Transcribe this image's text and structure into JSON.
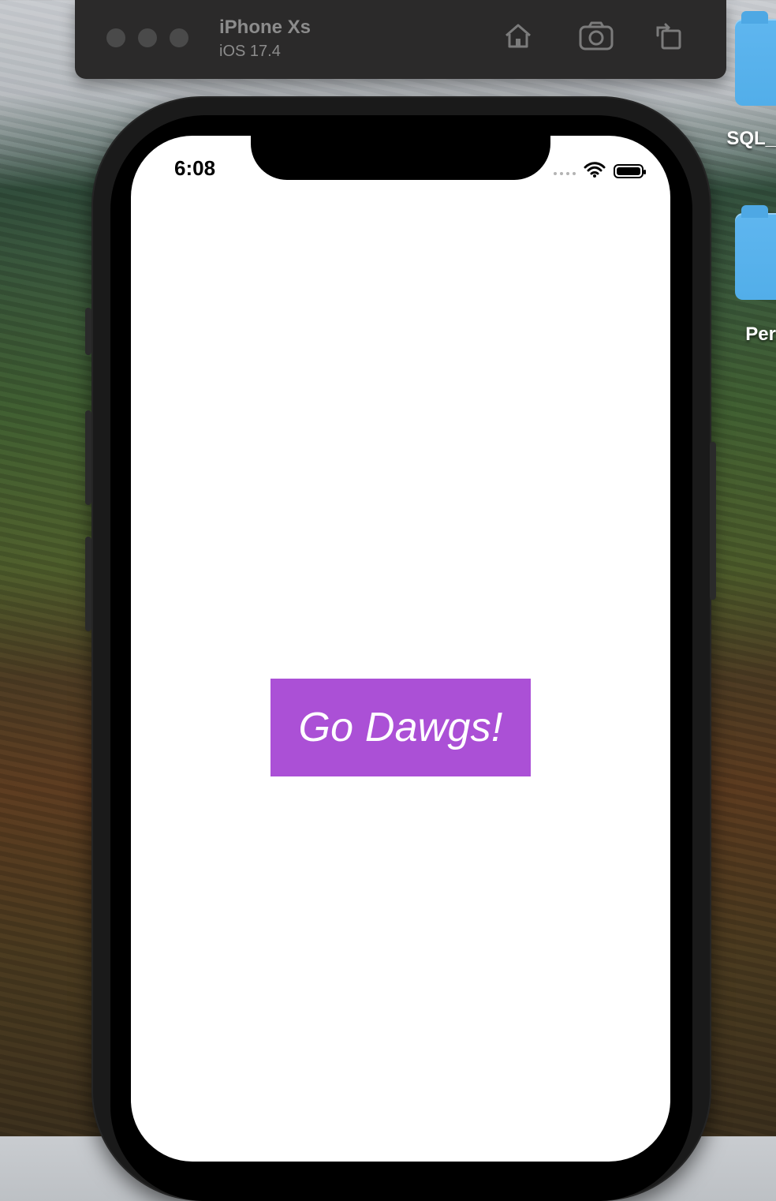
{
  "simulator": {
    "device_name": "iPhone Xs",
    "os_version": "iOS 17.4",
    "toolbar_icons": [
      "home-icon",
      "screenshot-icon",
      "rotate-icon"
    ]
  },
  "desktop": {
    "items": [
      {
        "label": "SQL_",
        "icon": "folder-icon"
      },
      {
        "label": "Per",
        "icon": "folder-icon"
      }
    ]
  },
  "status_bar": {
    "time": "6:08",
    "icons": [
      "cellular-signal-icon",
      "wifi-icon",
      "battery-icon"
    ]
  },
  "app": {
    "button_label": "Go Dawgs!",
    "button_color": "#ab50d6"
  }
}
